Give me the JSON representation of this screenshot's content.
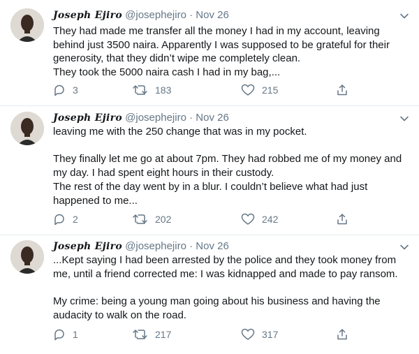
{
  "tweets": [
    {
      "name": "Joseph Ejiro",
      "handle": "@josephejiro",
      "separator": "·",
      "date": "Nov 26",
      "text": "They had made me transfer all the money I had in my account, leaving behind just 3500 naira. Apparently I was supposed to be grateful for their generosity, that they didn’t wipe me completely clean.\nThey took the 5000 naira cash I had in my bag,...",
      "replies": "3",
      "retweets": "183",
      "likes": "215"
    },
    {
      "name": "Joseph Ejiro",
      "handle": "@josephejiro",
      "separator": "·",
      "date": "Nov 26",
      "text": "leaving me with the 250 change that was in my pocket.\n\nThey finally let me go at about 7pm. They had robbed me of my money and my day. I had spent eight hours in their custody.\nThe rest of the day went by in a blur. I couldn’t believe what had just happened to me...",
      "replies": "2",
      "retweets": "202",
      "likes": "242"
    },
    {
      "name": "Joseph Ejiro",
      "handle": "@josephejiro",
      "separator": "·",
      "date": "Nov 26",
      "text": "...Kept saying I had been arrested by the police and they took money from me, until a friend corrected me: I was kidnapped and made to pay ransom.\n\nMy crime: being a young man going about his business and having the audacity to walk on the road.",
      "replies": "1",
      "retweets": "217",
      "likes": "317"
    }
  ],
  "icons": {
    "reply": "reply-icon",
    "retweet": "retweet-icon",
    "like": "heart-icon",
    "share": "share-icon",
    "more": "chevron-down-icon"
  },
  "colors": {
    "text": "#14171a",
    "secondary": "#657786",
    "divider": "#e6ecf0"
  }
}
